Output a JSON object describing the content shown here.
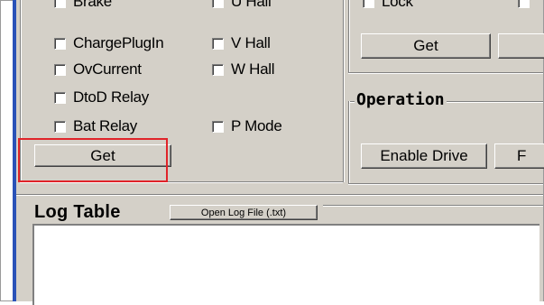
{
  "left_group": {
    "row1": [
      "Brake",
      "U Hall"
    ],
    "row2": [
      "ChargePlugIn",
      "V Hall"
    ],
    "row3": [
      "OvCurrent",
      "W Hall"
    ],
    "row4": [
      "DtoD Relay"
    ],
    "row5": [
      "Bat Relay",
      "P Mode"
    ],
    "get_button": "Get"
  },
  "right_group": {
    "lock_label": "Lock",
    "get_button": "Get",
    "operation_title": "Operation",
    "enable_drive_button": "Enable Drive",
    "next_button_partial": "F"
  },
  "log": {
    "title": "Log Table",
    "open_button": "Open Log File (.txt)"
  },
  "colors": {
    "window_bg": "#d4d0c8",
    "accent_bar": "#2a52b8",
    "highlight": "#e0242a"
  }
}
